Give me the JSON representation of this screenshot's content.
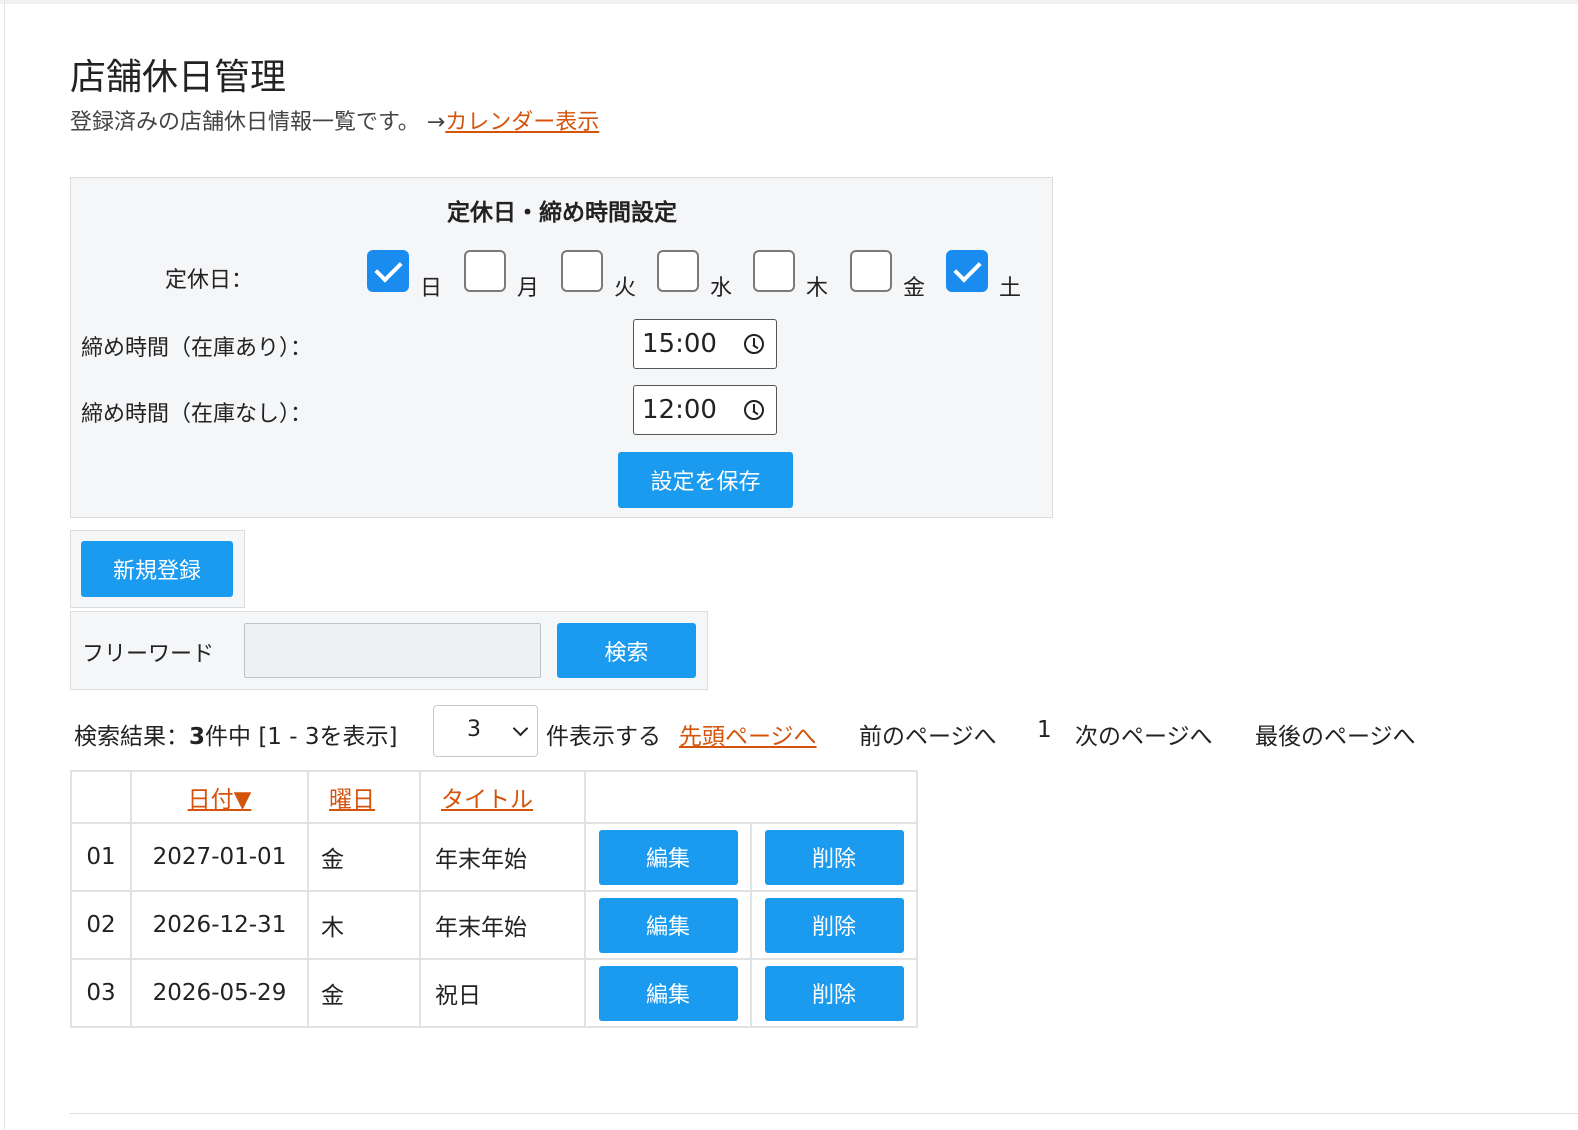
{
  "page": {
    "title": "店舗休日管理",
    "subtitle": "登録済みの店舗休日情報一覧です。 →",
    "calendar_link": "カレンダー表示"
  },
  "settings": {
    "title": "定休日・締め時間設定",
    "holiday_label": "定休日：",
    "days": [
      {
        "label": "日",
        "checked": true
      },
      {
        "label": "月",
        "checked": false
      },
      {
        "label": "火",
        "checked": false
      },
      {
        "label": "水",
        "checked": false
      },
      {
        "label": "木",
        "checked": false
      },
      {
        "label": "金",
        "checked": false
      },
      {
        "label": "土",
        "checked": true
      }
    ],
    "cutoff_in_stock_label": "締め時間（在庫あり）：",
    "cutoff_in_stock_value": "15:00",
    "cutoff_no_stock_label": "締め時間（在庫なし）：",
    "cutoff_no_stock_value": "12:00",
    "save_label": "設定を保存"
  },
  "actions": {
    "new_label": "新規登録"
  },
  "search": {
    "label": "フリーワード",
    "value": "",
    "button_label": "検索"
  },
  "pager": {
    "result_prefix": "検索結果：",
    "total": "3",
    "result_suffix": "件中 [1 - 3を表示]",
    "per_page": "3",
    "per_page_suffix": "件表示する",
    "first": "先頭ページへ",
    "prev": "前のページへ",
    "current": "1",
    "next": "次のページへ",
    "last": "最後のページへ"
  },
  "table": {
    "headers": {
      "date": "日付▼",
      "weekday": "曜日",
      "title": "タイトル"
    },
    "edit_label": "編集",
    "delete_label": "削除",
    "rows": [
      {
        "no": "01",
        "date": "2027-01-01",
        "weekday": "金",
        "title": "年末年始"
      },
      {
        "no": "02",
        "date": "2026-12-31",
        "weekday": "木",
        "title": "年末年始"
      },
      {
        "no": "03",
        "date": "2026-05-29",
        "weekday": "金",
        "title": "祝日"
      }
    ]
  },
  "colors": {
    "accent": "#1a9bef",
    "link": "#d4540c",
    "panel_bg": "#f5f6f8"
  }
}
